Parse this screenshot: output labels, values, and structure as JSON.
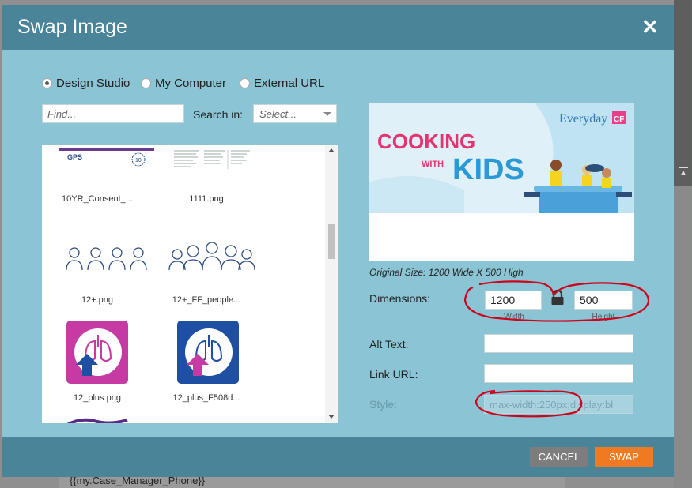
{
  "background": {
    "bottom_text": "{{my.Case_Manager_Phone}}"
  },
  "modal": {
    "title": "Swap Image",
    "close_glyph": "✕"
  },
  "source_options": [
    {
      "label": "Design Studio",
      "checked": true
    },
    {
      "label": "My Computer",
      "checked": false
    },
    {
      "label": "External URL",
      "checked": false
    }
  ],
  "search": {
    "placeholder": "Find...",
    "search_in_label": "Search in:",
    "select_placeholder": "Select..."
  },
  "files": [
    {
      "name": "10YR_Consent_...",
      "thumb": "gps-document"
    },
    {
      "name": "1111.png",
      "thumb": "text-document"
    },
    {
      "name": "12+.png",
      "thumb": "people-outline"
    },
    {
      "name": "12+_FF_people...",
      "thumb": "people-outline-group"
    },
    {
      "name": "12_plus.png",
      "thumb": "lungs-magenta"
    },
    {
      "name": "12_plus_F508d...",
      "thumb": "lungs-blue"
    }
  ],
  "file_thumb_text": {
    "gps": "GPS",
    "badge": "10"
  },
  "preview": {
    "brand_text": "Everyday",
    "brand_badge": "CF",
    "headline_line1": "COOKING",
    "headline_with": "WITH",
    "headline_line2": "KIDS",
    "original_size": "Original Size: 1200 Wide X 500 High"
  },
  "dimensions": {
    "label": "Dimensions:",
    "width_value": "1200",
    "height_value": "500",
    "width_sublabel": "Width",
    "height_sublabel": "Height",
    "lock_icon": "lock-icon"
  },
  "alt_text": {
    "label": "Alt Text:",
    "value": ""
  },
  "link_url": {
    "label": "Link URL:",
    "value": ""
  },
  "style": {
    "label": "Style:",
    "value": "max-width:250px;display:bl"
  },
  "buttons": {
    "cancel": "CANCEL",
    "swap": "SWAP"
  },
  "colors": {
    "header": "#4a8499",
    "body": "#8bc4d4",
    "swap_button": "#f07a21",
    "cancel_button": "#7d7d7d",
    "annotation": "#d0021b"
  }
}
